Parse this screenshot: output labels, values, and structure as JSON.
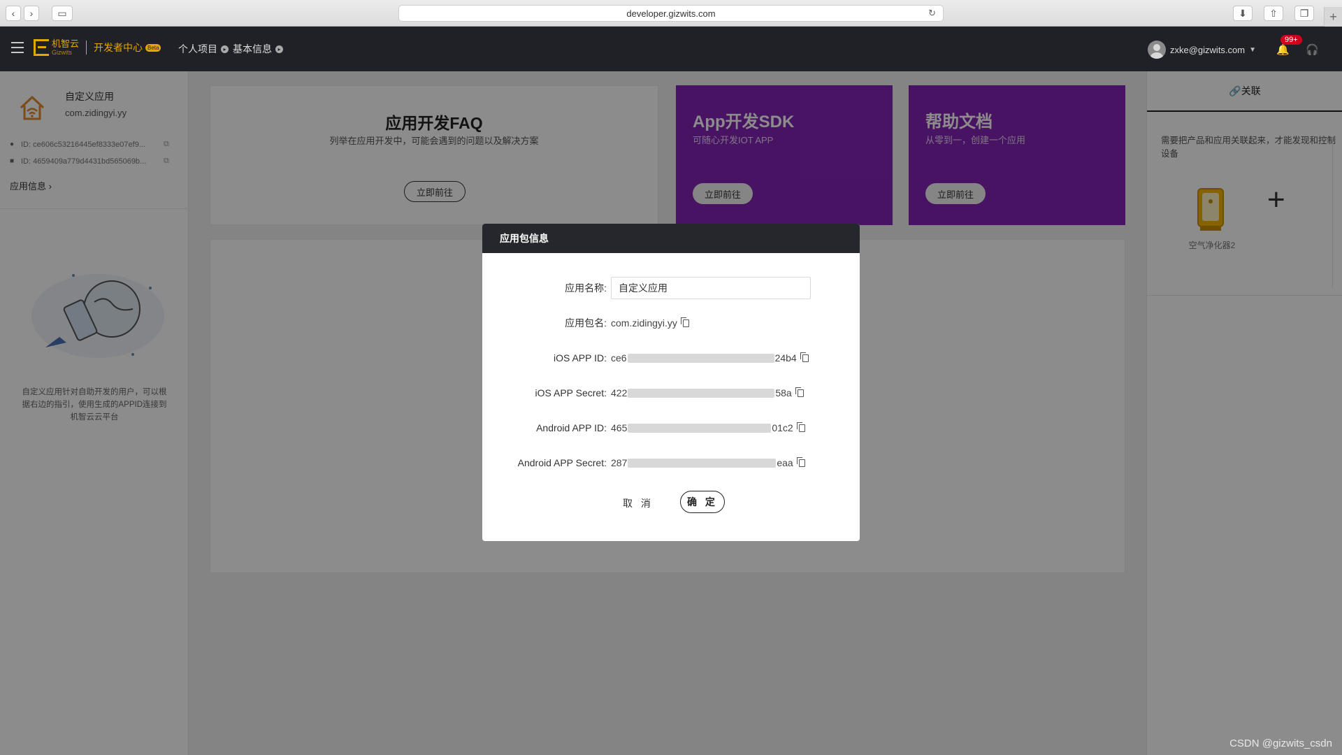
{
  "browser": {
    "url": "developer.gizwits.com"
  },
  "topnav": {
    "logo_cn": "机智云",
    "logo_en": "Gizwits",
    "dev_center": "开发者中心",
    "beta": "Beta",
    "crumbs": [
      "个人项目",
      "基本信息"
    ],
    "user_email": "zxke@gizwits.com",
    "notifications": "99+"
  },
  "sidebar": {
    "app_name": "自定义应用",
    "package": "com.zidingyi.yy",
    "ios_id": "ID: ce606c53216445ef8333e07ef9...",
    "android_id": "ID: 4659409a779d4431bd565069b...",
    "app_info_link": "应用信息",
    "description": "自定义应用针对自助开发的用户，可以根据右边的指引，使用生成的APPID连接到机智云云平台"
  },
  "cards": {
    "faq": {
      "title": "应用开发FAQ",
      "subtitle": "列举在应用开发中，可能会遇到的问题以及解决方案",
      "button": "立即前往"
    },
    "sdk": {
      "title": "App开发SDK",
      "subtitle": "可随心开发IOT APP",
      "button": "立即前往"
    },
    "docs": {
      "title": "帮助文档",
      "subtitle": "从零到一，创建一个应用",
      "button": "立即前往"
    }
  },
  "right_panel": {
    "tab": "关联",
    "text": "需要把产品和应用关联起来，才能发现和控制设备",
    "device_label": "空气净化器2"
  },
  "modal": {
    "title": "应用包信息",
    "fields": {
      "app_name_label": "应用名称:",
      "app_name_value": "自定义应用",
      "package_label": "应用包名:",
      "package_value": "com.zidingyi.yy",
      "ios_id_label": "iOS APP ID:",
      "ios_id_prefix": "ce6",
      "ios_id_suffix": "24b4",
      "ios_secret_label": "iOS APP Secret:",
      "ios_secret_prefix": "422",
      "ios_secret_suffix": "58a",
      "android_id_label": "Android APP ID:",
      "android_id_prefix": "465",
      "android_id_suffix": "01c2",
      "android_secret_label": "Android APP Secret:",
      "android_secret_prefix": "287",
      "android_secret_suffix": "eaa"
    },
    "cancel": "取 消",
    "ok": "确 定"
  },
  "watermark": "CSDN @gizwits_csdn",
  "colors": {
    "nav_bg": "#1f2127",
    "accent": "#e0a800",
    "purple": "#8424b4",
    "badge": "#d0021b"
  }
}
